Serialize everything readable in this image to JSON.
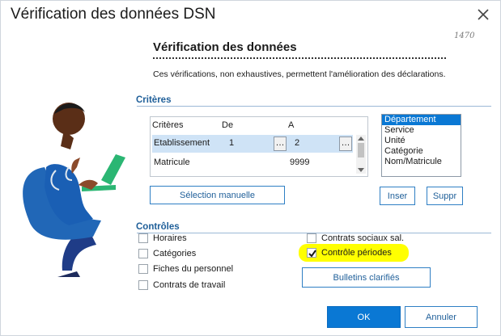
{
  "window": {
    "title": "Vérification des données DSN",
    "code": "1470"
  },
  "header": {
    "title": "Vérification des données",
    "description": "Ces vérifications, non exhaustives, permettent l'amélioration des déclarations."
  },
  "criteres": {
    "section_label": "Critères",
    "columns": [
      "Critères",
      "De",
      "A"
    ],
    "rows": [
      {
        "critere": "Etablissement",
        "de": "1",
        "a": "2"
      },
      {
        "critere": "Matricule",
        "de": "",
        "a": "9999"
      }
    ],
    "selection_button": "Sélection manuelle",
    "sort_options": [
      "Département",
      "Service",
      "Unité",
      "Catégorie",
      "Nom/Matricule"
    ],
    "selected_sort": "Département",
    "insert_button": "Inser",
    "delete_button": "Suppr"
  },
  "controles": {
    "section_label": "Contrôles",
    "left": [
      {
        "label": "Horaires",
        "checked": false
      },
      {
        "label": "Catégories",
        "checked": false
      },
      {
        "label": "Fiches du personnel",
        "checked": false
      },
      {
        "label": "Contrats de travail",
        "checked": false
      }
    ],
    "right": [
      {
        "label": "Contrats sociaux sal.",
        "checked": false
      },
      {
        "label": "Contrôle périodes",
        "checked": true
      }
    ],
    "bulletins_button": "Bulletins clarifiés"
  },
  "footer": {
    "ok_label": "OK",
    "cancel_label": "Annuler"
  },
  "colors": {
    "accent": "#0a78d4",
    "section": "#1f5f99",
    "highlight": "#ffff00"
  }
}
